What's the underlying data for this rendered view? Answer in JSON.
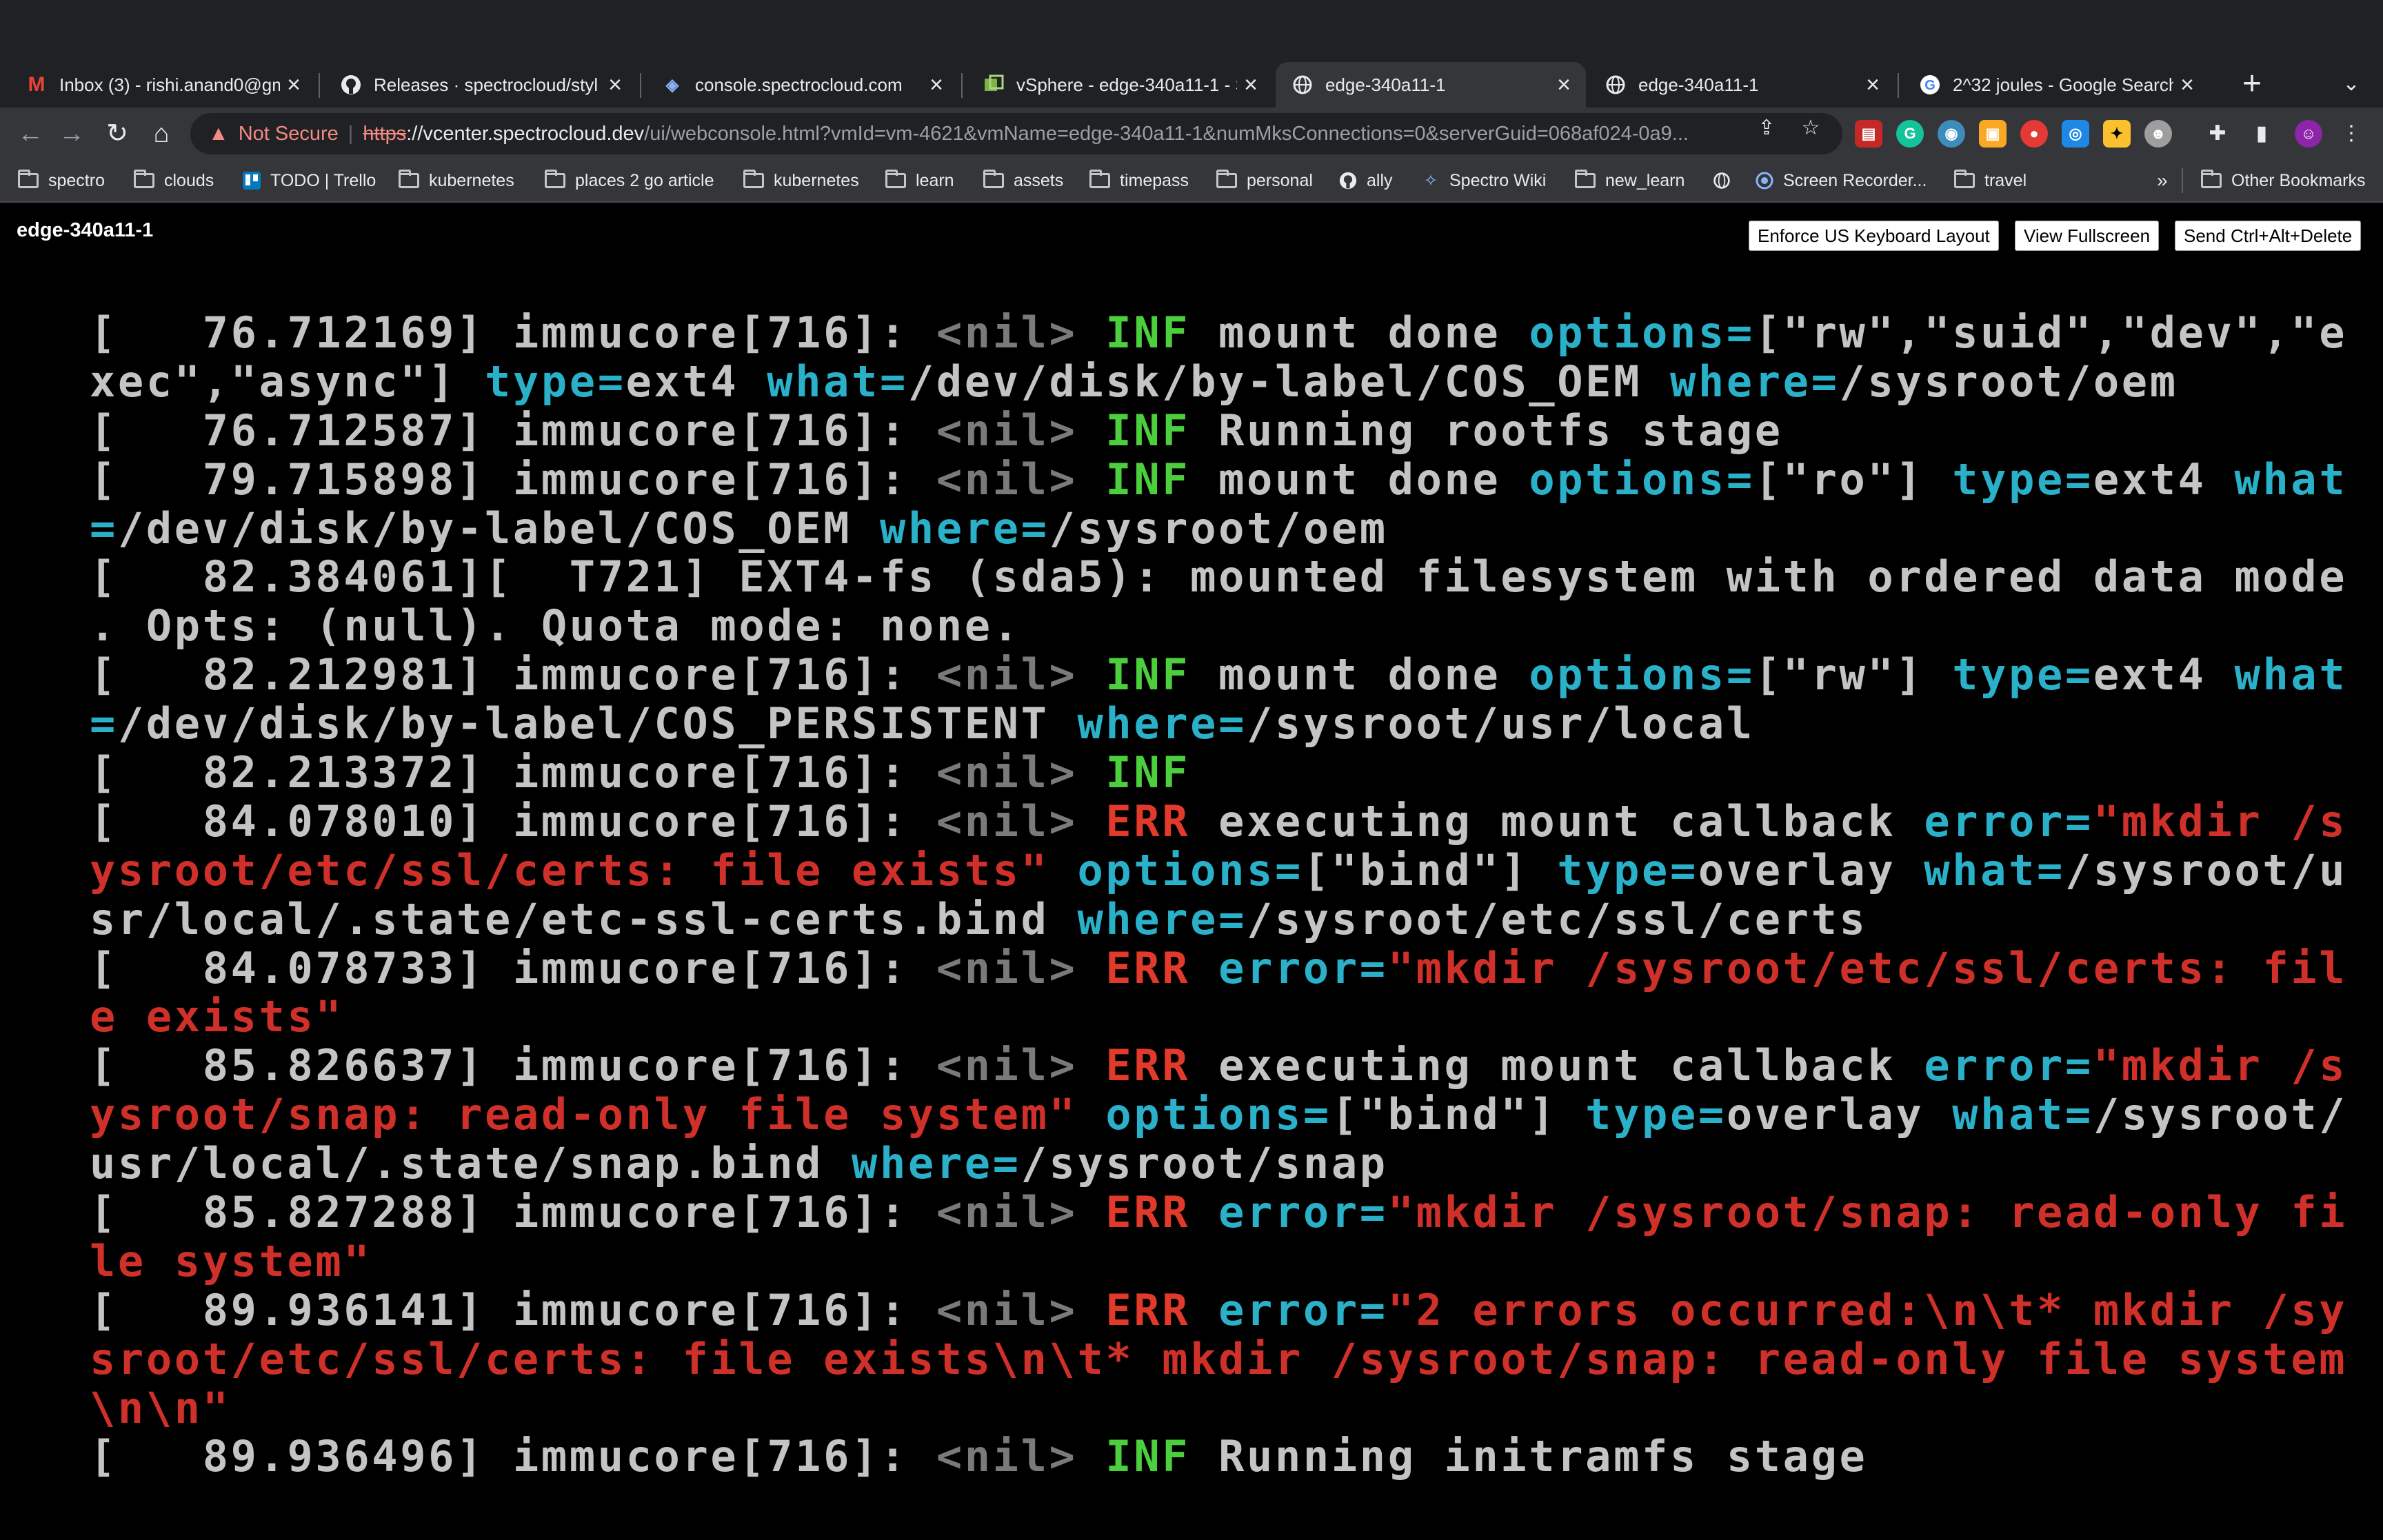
{
  "browser": {
    "tabs": [
      {
        "title": "Inbox (3) - rishi.anand0@gm",
        "icon": "gmail-icon",
        "active": false
      },
      {
        "title": "Releases · spectrocloud/styl",
        "icon": "github-icon",
        "active": false
      },
      {
        "title": "console.spectrocloud.com",
        "icon": "spectrocloud-icon",
        "active": false
      },
      {
        "title": "vSphere - edge-340a11-1 - S",
        "icon": "vsphere-icon",
        "active": false
      },
      {
        "title": "edge-340a11-1",
        "icon": "globe-icon",
        "active": true
      },
      {
        "title": "edge-340a11-1",
        "icon": "globe-icon",
        "active": false
      },
      {
        "title": "2^32 joules - Google Search",
        "icon": "google-icon",
        "active": false
      }
    ],
    "new_tab": "+",
    "address": {
      "security_label": "Not Secure",
      "scheme": "https",
      "rest": "://vcenter.spectrocloud.dev",
      "path": "/ui/webconsole.html?vmId=vm-4621&vmName=edge-340a11-1&numMksConnections=0&serverGuid=068af024-0a9..."
    },
    "bookmarks": [
      {
        "label": "spectro",
        "icon": "folder-icon"
      },
      {
        "label": "clouds",
        "icon": "folder-icon"
      },
      {
        "label": "TODO | Trello",
        "icon": "trello-icon"
      },
      {
        "label": "kubernetes",
        "icon": "folder-icon"
      },
      {
        "label": "places 2 go article",
        "icon": "folder-icon"
      },
      {
        "label": "kubernetes",
        "icon": "folder-icon"
      },
      {
        "label": "learn",
        "icon": "folder-icon"
      },
      {
        "label": "assets",
        "icon": "folder-icon"
      },
      {
        "label": "timepass",
        "icon": "folder-icon"
      },
      {
        "label": "personal",
        "icon": "folder-icon"
      },
      {
        "label": "ally",
        "icon": "github-icon"
      },
      {
        "label": "Spectro Wiki",
        "icon": "spectro-icon"
      },
      {
        "label": "new_learn",
        "icon": "folder-icon"
      },
      {
        "label": "",
        "icon": "globe-icon"
      },
      {
        "label": "Screen Recorder...",
        "icon": "record-icon"
      },
      {
        "label": "travel",
        "icon": "folder-icon"
      }
    ],
    "bookmarks_overflow": "»",
    "other_bookmarks": "Other Bookmarks"
  },
  "page": {
    "vm_name": "edge-340a11-1",
    "buttons": {
      "enforce_us_keyboard": "Enforce US Keyboard Layout",
      "view_fullscreen": "View Fullscreen",
      "send_ctrl_alt_delete": "Send Ctrl+Alt+Delete"
    }
  },
  "console": {
    "lines": [
      [
        [
          "w",
          "[   76.712169] immucore[716]: "
        ],
        [
          "dim",
          "<nil> "
        ],
        [
          "inf",
          "INF "
        ],
        [
          "w",
          "mount done "
        ],
        [
          "key",
          "options="
        ],
        [
          "w",
          "[\"rw\",\"suid\",\"dev\",\"e"
        ]
      ],
      [
        [
          "w",
          "xec\",\"async\"] "
        ],
        [
          "key",
          "type="
        ],
        [
          "w",
          "ext4 "
        ],
        [
          "key",
          "what="
        ],
        [
          "w",
          "/dev/disk/by-label/COS_OEM "
        ],
        [
          "key",
          "where="
        ],
        [
          "w",
          "/sysroot/oem"
        ]
      ],
      [
        [
          "w",
          "[   76.712587] immucore[716]: "
        ],
        [
          "dim",
          "<nil> "
        ],
        [
          "inf",
          "INF "
        ],
        [
          "w",
          "Running rootfs stage"
        ]
      ],
      [
        [
          "w",
          "[   79.715898] immucore[716]: "
        ],
        [
          "dim",
          "<nil> "
        ],
        [
          "inf",
          "INF "
        ],
        [
          "w",
          "mount done "
        ],
        [
          "key",
          "options="
        ],
        [
          "w",
          "[\"ro\"] "
        ],
        [
          "key",
          "type="
        ],
        [
          "w",
          "ext4 "
        ],
        [
          "key",
          "what"
        ]
      ],
      [
        [
          "key",
          "="
        ],
        [
          "w",
          "/dev/disk/by-label/COS_OEM "
        ],
        [
          "key",
          "where="
        ],
        [
          "w",
          "/sysroot/oem"
        ]
      ],
      [
        [
          "w",
          "[   82.384061][  T721] EXT4-fs (sda5): mounted filesystem with ordered data mode"
        ]
      ],
      [
        [
          "w",
          ". Opts: (null). Quota mode: none."
        ]
      ],
      [
        [
          "w",
          "[   82.212981] immucore[716]: "
        ],
        [
          "dim",
          "<nil> "
        ],
        [
          "inf",
          "INF "
        ],
        [
          "w",
          "mount done "
        ],
        [
          "key",
          "options="
        ],
        [
          "w",
          "[\"rw\"] "
        ],
        [
          "key",
          "type="
        ],
        [
          "w",
          "ext4 "
        ],
        [
          "key",
          "what"
        ]
      ],
      [
        [
          "key",
          "="
        ],
        [
          "w",
          "/dev/disk/by-label/COS_PERSISTENT "
        ],
        [
          "key",
          "where="
        ],
        [
          "w",
          "/sysroot/usr/local"
        ]
      ],
      [
        [
          "w",
          "[   82.213372] immucore[716]: "
        ],
        [
          "dim",
          "<nil> "
        ],
        [
          "inf",
          "INF"
        ]
      ],
      [
        [
          "w",
          "[   84.078010] immucore[716]: "
        ],
        [
          "dim",
          "<nil> "
        ],
        [
          "err",
          "ERR "
        ],
        [
          "w",
          "executing mount callback "
        ],
        [
          "key",
          "error="
        ],
        [
          "red",
          "\"mkdir /s"
        ]
      ],
      [
        [
          "red",
          "ysroot/etc/ssl/certs: file exists\" "
        ],
        [
          "key",
          "options="
        ],
        [
          "w",
          "[\"bind\"] "
        ],
        [
          "key",
          "type="
        ],
        [
          "w",
          "overlay "
        ],
        [
          "key",
          "what="
        ],
        [
          "w",
          "/sysroot/u"
        ]
      ],
      [
        [
          "w",
          "sr/local/.state/etc-ssl-certs.bind "
        ],
        [
          "key",
          "where="
        ],
        [
          "w",
          "/sysroot/etc/ssl/certs"
        ]
      ],
      [
        [
          "w",
          "[   84.078733] immucore[716]: "
        ],
        [
          "dim",
          "<nil> "
        ],
        [
          "err",
          "ERR "
        ],
        [
          "key",
          "error="
        ],
        [
          "red",
          "\"mkdir /sysroot/etc/ssl/certs: fil"
        ]
      ],
      [
        [
          "red",
          "e exists\""
        ]
      ],
      [
        [
          "w",
          "[   85.826637] immucore[716]: "
        ],
        [
          "dim",
          "<nil> "
        ],
        [
          "err",
          "ERR "
        ],
        [
          "w",
          "executing mount callback "
        ],
        [
          "key",
          "error="
        ],
        [
          "red",
          "\"mkdir /s"
        ]
      ],
      [
        [
          "red",
          "ysroot/snap: read-only file system\" "
        ],
        [
          "key",
          "options="
        ],
        [
          "w",
          "[\"bind\"] "
        ],
        [
          "key",
          "type="
        ],
        [
          "w",
          "overlay "
        ],
        [
          "key",
          "what="
        ],
        [
          "w",
          "/sysroot/"
        ]
      ],
      [
        [
          "w",
          "usr/local/.state/snap.bind "
        ],
        [
          "key",
          "where="
        ],
        [
          "w",
          "/sysroot/snap"
        ]
      ],
      [
        [
          "w",
          "[   85.827288] immucore[716]: "
        ],
        [
          "dim",
          "<nil> "
        ],
        [
          "err",
          "ERR "
        ],
        [
          "key",
          "error="
        ],
        [
          "red",
          "\"mkdir /sysroot/snap: read-only fi"
        ]
      ],
      [
        [
          "red",
          "le system\""
        ]
      ],
      [
        [
          "w",
          "[   89.936141] immucore[716]: "
        ],
        [
          "dim",
          "<nil> "
        ],
        [
          "err",
          "ERR "
        ],
        [
          "key",
          "error="
        ],
        [
          "red",
          "\"2 errors occurred:\\n\\t* mkdir /sy"
        ]
      ],
      [
        [
          "red",
          "sroot/etc/ssl/certs: file exists\\n\\t* mkdir /sysroot/snap: read-only file system"
        ]
      ],
      [
        [
          "red",
          "\\n\\n\""
        ]
      ],
      [
        [
          "w",
          "[   89.936496] immucore[716]: "
        ],
        [
          "dim",
          "<nil> "
        ],
        [
          "inf",
          "INF "
        ],
        [
          "w",
          "Running initramfs stage"
        ]
      ]
    ]
  }
}
